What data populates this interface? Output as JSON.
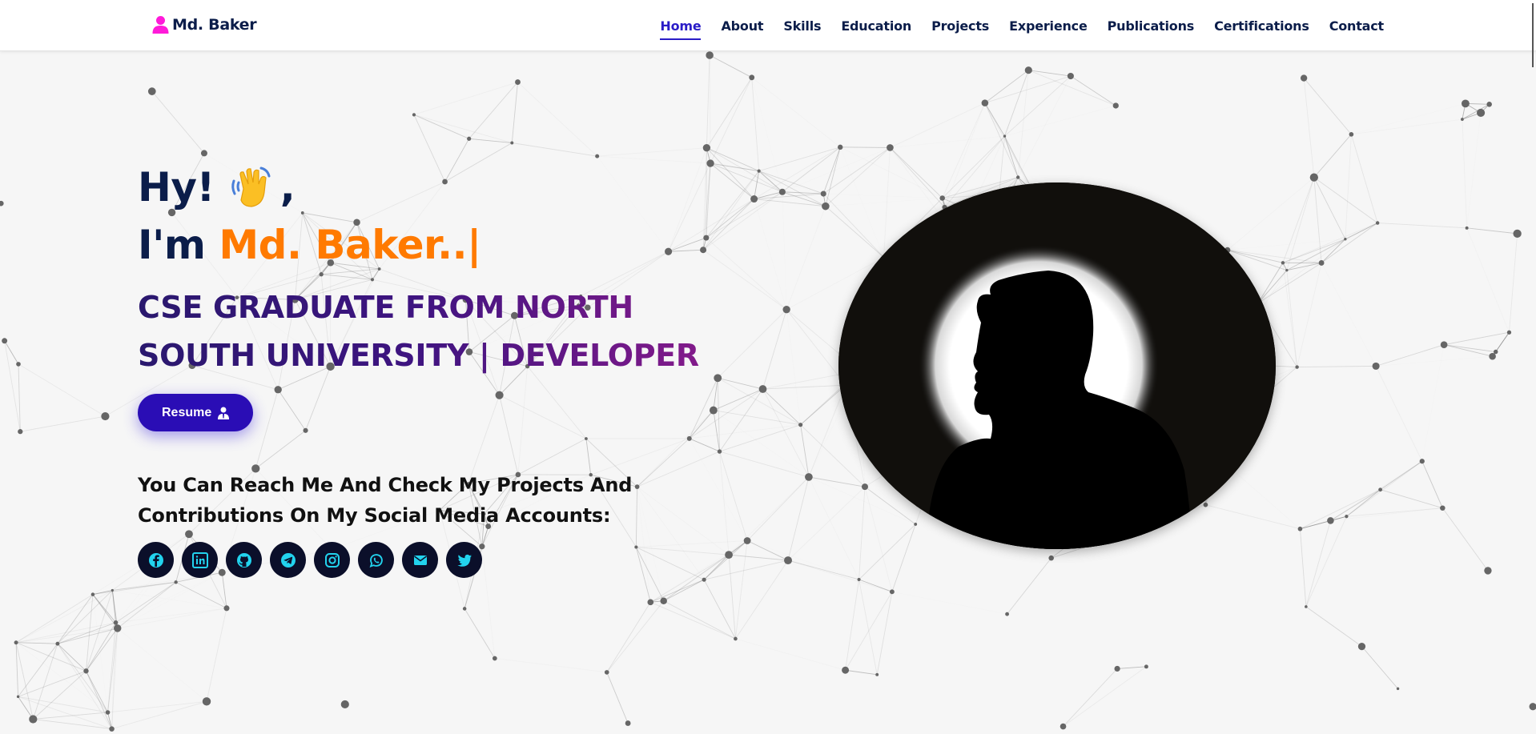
{
  "header": {
    "logo_text": "Md. Baker",
    "logo_icon": "user-icon",
    "accent_color": "#ff1ad9",
    "nav": [
      {
        "label": "Home",
        "active": true
      },
      {
        "label": "About"
      },
      {
        "label": "Skills"
      },
      {
        "label": "Education"
      },
      {
        "label": "Projects"
      },
      {
        "label": "Experience"
      },
      {
        "label": "Publications"
      },
      {
        "label": "Certifications"
      },
      {
        "label": "Contact"
      }
    ]
  },
  "hero": {
    "greeting": "Hy!",
    "greeting_emoji": "waving-hand",
    "greeting_suffix": ",",
    "intro_prefix": "I'm ",
    "name": "Md. Baker..|",
    "role": "CSE GRADUATE FROM NORTH SOUTH UNIVERSITY | DEVELOPER",
    "resume_label": "Resume",
    "reach_text": "You Can Reach Me And Check My Projects And Contributions On My Social Media Accounts:",
    "socials": [
      "facebook-icon",
      "linkedin-icon",
      "github-icon",
      "telegram-icon",
      "instagram-icon",
      "whatsapp-icon",
      "email-icon",
      "twitter-icon"
    ],
    "social_icon_color": "#22d3ee",
    "name_color": "#ff7a00",
    "resume_color": "#2a0db5"
  }
}
